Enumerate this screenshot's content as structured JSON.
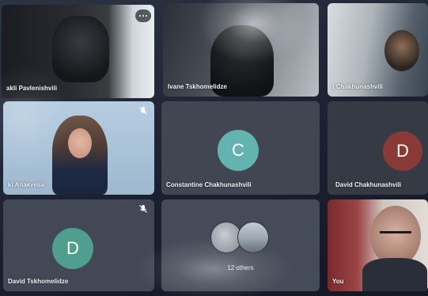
{
  "participants": [
    {
      "name": "akli Pavlenishvili"
    },
    {
      "name": "Ivane Tskhomelidze"
    },
    {
      "name": "t Chakhunashvili"
    },
    {
      "name": "ki Anakvelia"
    },
    {
      "name": "Constantine Chakhunashvili",
      "initial": "C",
      "avatar_color": "#63b4b0"
    },
    {
      "name": "David Chakhunashvili",
      "initial": "D",
      "avatar_color": "#8a3a36"
    },
    {
      "name": "David Tskhomelidze",
      "initial": "D",
      "avatar_color": "#4f9e8e"
    },
    {
      "name": "12 others"
    },
    {
      "name": "You"
    }
  ],
  "icons": {
    "mute": "microphone-off-icon",
    "more": "more-options-icon"
  }
}
